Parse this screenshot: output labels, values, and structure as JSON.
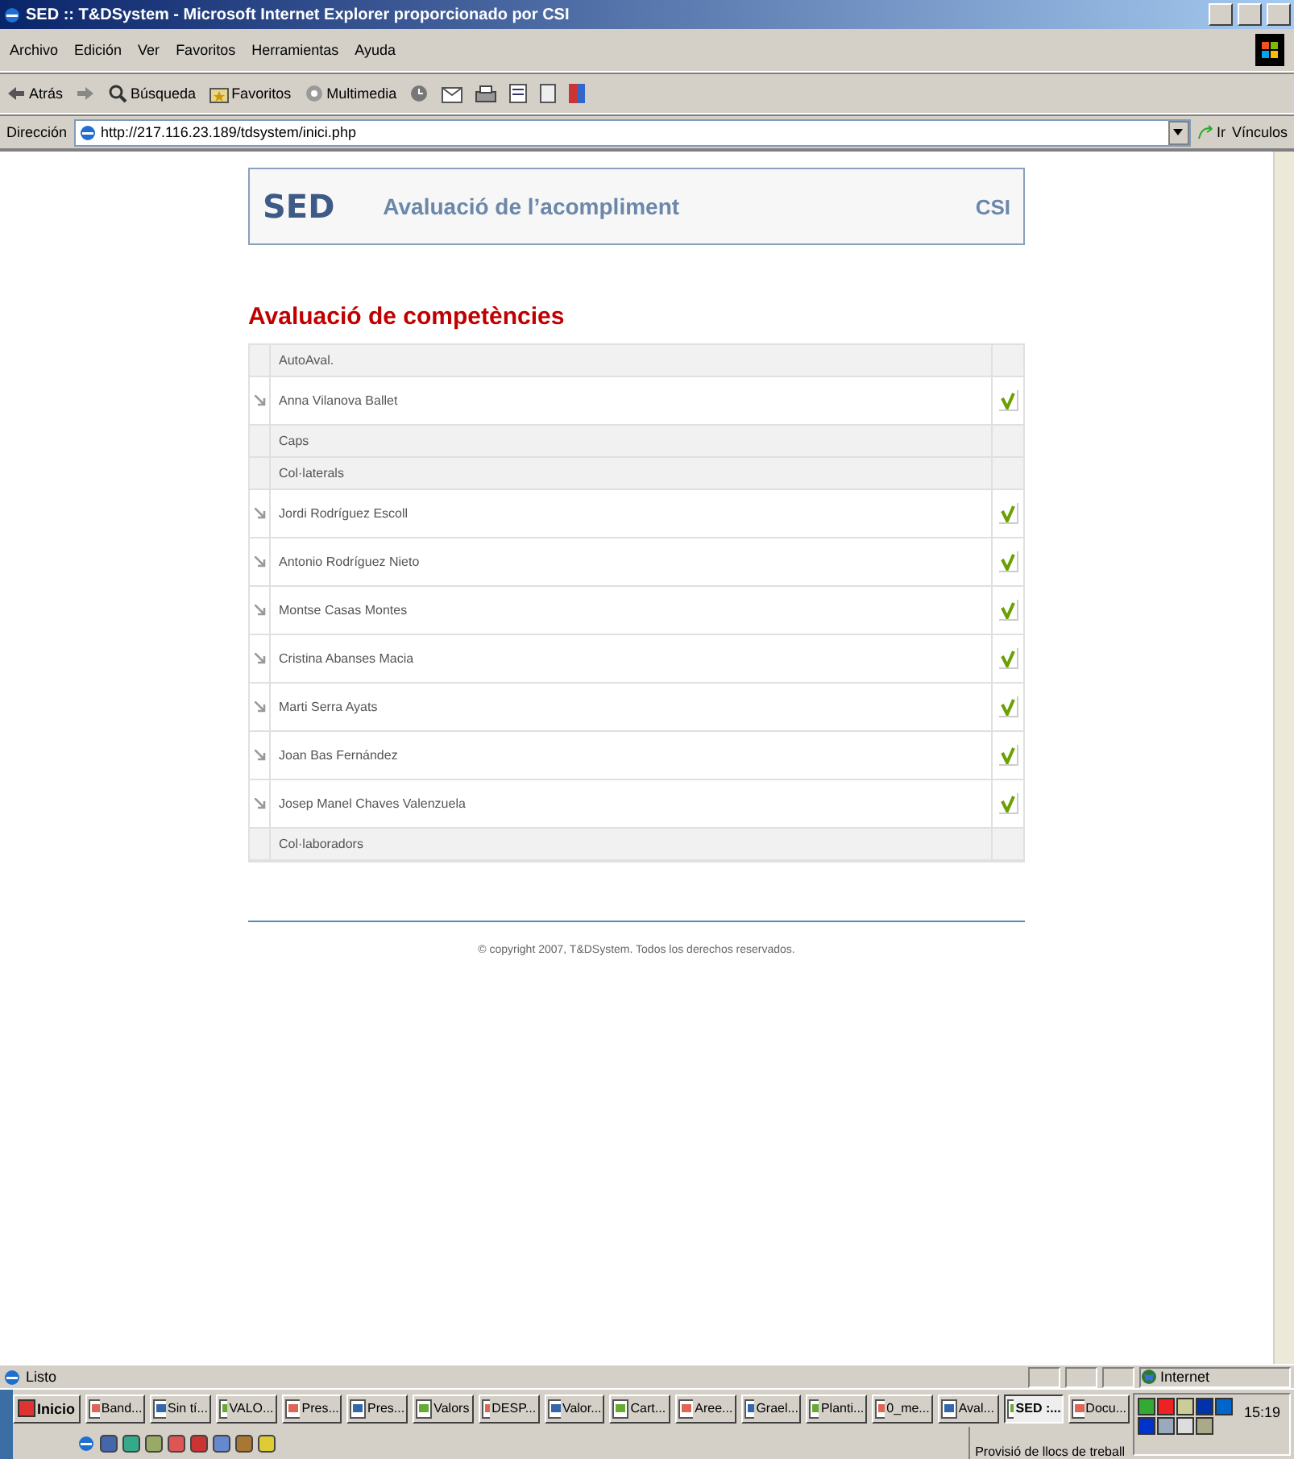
{
  "window": {
    "title": "SED :: T&DSystem - Microsoft Internet Explorer proporcionado por CSI"
  },
  "menu": [
    "Archivo",
    "Edición",
    "Ver",
    "Favoritos",
    "Herramientas",
    "Ayuda"
  ],
  "toolbar": [
    {
      "kind": "back",
      "label": "Atrás"
    },
    {
      "kind": "forward"
    },
    {
      "kind": "search",
      "label": "Búsqueda"
    },
    {
      "kind": "favorites",
      "label": "Favoritos"
    },
    {
      "kind": "media",
      "label": "Multimedia"
    }
  ],
  "address": {
    "label": "Dirección",
    "url": "http://217.116.23.189/tdsystem/inici.php",
    "go": "Ir",
    "links": "Vínculos"
  },
  "page": {
    "header": {
      "logo": "SED",
      "title": "Avaluació de l’acompliment",
      "org": "CSI"
    },
    "heading": "Avaluació de competències",
    "rows": [
      {
        "kind": "group",
        "label": "AutoAval."
      },
      {
        "kind": "person",
        "label": "Anna Vilanova Ballet",
        "done": true
      },
      {
        "kind": "group",
        "label": "Caps"
      },
      {
        "kind": "group",
        "label": "Col·laterals"
      },
      {
        "kind": "person",
        "label": "Jordi Rodríguez Escoll",
        "done": true
      },
      {
        "kind": "person",
        "label": "Antonio Rodríguez Nieto",
        "done": true
      },
      {
        "kind": "person",
        "label": "Montse Casas Montes",
        "done": true
      },
      {
        "kind": "person",
        "label": "Cristina Abanses Macia",
        "done": true
      },
      {
        "kind": "person",
        "label": "Marti Serra Ayats",
        "done": true
      },
      {
        "kind": "person",
        "label": "Joan Bas Fernández",
        "done": true
      },
      {
        "kind": "person",
        "label": "Josep Manel Chaves Valenzuela",
        "done": true
      },
      {
        "kind": "group",
        "label": "Col·laboradors"
      }
    ],
    "footer": "© copyright 2007, T&DSystem. Todos los derechos reservados."
  },
  "status_bar": {
    "text": "Listo",
    "zone": "Internet"
  },
  "taskbar": {
    "start": "Inicio",
    "tasks": [
      {
        "label": "Band...",
        "selected": false
      },
      {
        "label": "Sin tí...",
        "selected": false
      },
      {
        "label": "VALO...",
        "selected": false
      },
      {
        "label": "Pres...",
        "selected": false
      },
      {
        "label": "Pres...",
        "selected": false
      },
      {
        "label": "Valors",
        "selected": false
      },
      {
        "label": "DESP...",
        "selected": false
      },
      {
        "label": "Valor...",
        "selected": false
      },
      {
        "label": "Cart...",
        "selected": false
      },
      {
        "label": "Aree...",
        "selected": false
      },
      {
        "label": "Grael...",
        "selected": false
      },
      {
        "label": "Planti...",
        "selected": false
      },
      {
        "label": "0_me...",
        "selected": false
      },
      {
        "label": "Aval...",
        "selected": false
      },
      {
        "label": "SED :...",
        "selected": true
      },
      {
        "label": "Docu...",
        "selected": false
      }
    ],
    "toolbar": "Provisió de llocs de treball",
    "clock": "15:19"
  }
}
